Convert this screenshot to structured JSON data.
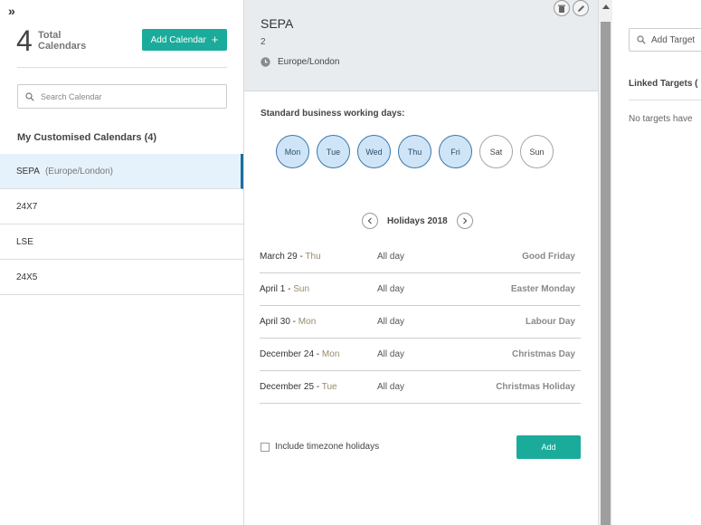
{
  "left": {
    "collapse_glyph": "»",
    "count": "4",
    "count_label_1": "Total",
    "count_label_2": "Calendars",
    "add_calendar_label": "Add Calendar",
    "add_glyph": "+",
    "search_placeholder": "Search Calendar",
    "section_title": "My Customised Calendars (4)",
    "calendars": [
      {
        "name": "SEPA",
        "tz": "(Europe/London)",
        "active": true
      },
      {
        "name": "24X7",
        "tz": "",
        "active": false
      },
      {
        "name": "LSE",
        "tz": "",
        "active": false
      },
      {
        "name": "24X5",
        "tz": "",
        "active": false
      }
    ]
  },
  "detail": {
    "title": "SEPA",
    "subtitle": "2",
    "timezone": "Europe/London",
    "working_days_label": "Standard business working days:",
    "days": [
      {
        "label": "Mon",
        "on": true
      },
      {
        "label": "Tue",
        "on": true
      },
      {
        "label": "Wed",
        "on": true
      },
      {
        "label": "Thu",
        "on": true
      },
      {
        "label": "Fri",
        "on": true
      },
      {
        "label": "Sat",
        "on": false
      },
      {
        "label": "Sun",
        "on": false
      }
    ],
    "holidays_title": "Holidays 2018",
    "holidays": [
      {
        "date": "March 29",
        "dow": "Thu",
        "span": "All day",
        "name": "Good Friday"
      },
      {
        "date": "April 1",
        "dow": "Sun",
        "span": "All day",
        "name": "Easter Monday"
      },
      {
        "date": "April 30",
        "dow": "Mon",
        "span": "All day",
        "name": "Labour Day"
      },
      {
        "date": "December 24",
        "dow": "Mon",
        "span": "All day",
        "name": "Christmas Day"
      },
      {
        "date": "December 25",
        "dow": "Tue",
        "span": "All day",
        "name": "Christmas Holiday"
      }
    ],
    "include_tz_label": "Include timezone holidays",
    "add_label": "Add"
  },
  "targets": {
    "placeholder": "Add Target",
    "linked_title": "Linked Targets (",
    "empty_text": "No targets have"
  },
  "colors": {
    "accent": "#1aab9b",
    "selected_day": "#cfe5f7",
    "active_row": "#e6f2fb"
  }
}
